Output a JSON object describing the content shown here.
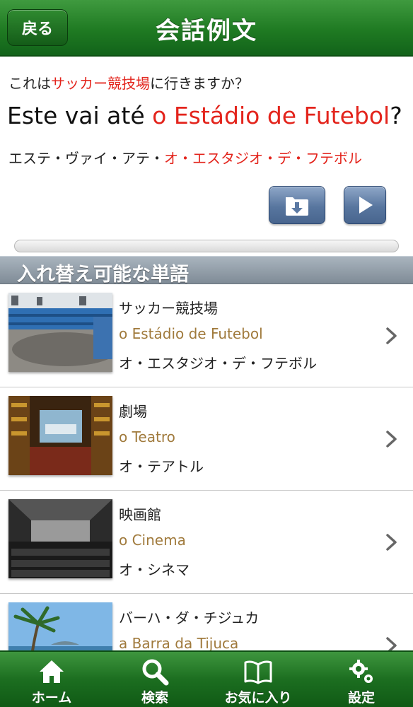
{
  "header": {
    "back_label": "戻る",
    "title": "会話例文"
  },
  "phrase": {
    "ja_prefix": "これは",
    "ja_highlight": "サッカー競技場",
    "ja_suffix": "に行きますか？",
    "pt_prefix": "Este vai até ",
    "pt_highlight": "o Estádio de Futebol",
    "pt_suffix": "?",
    "kana_prefix": "エステ・ヴァイ・アテ・",
    "kana_highlight": "オ・エスタジオ・デ・フテボル",
    "save_icon": "folder-download-icon",
    "play_icon": "play-icon"
  },
  "section": {
    "title": "入れ替え可能な単語"
  },
  "words": [
    {
      "ja": "サッカー競技場",
      "pt": "o Estádio de Futebol",
      "kana": "オ・エスタジオ・デ・フテボル",
      "image": "stadium"
    },
    {
      "ja": "劇場",
      "pt": "o Teatro",
      "kana": "オ・テアトル",
      "image": "theater"
    },
    {
      "ja": "映画館",
      "pt": "o Cinema",
      "kana": "オ・シネマ",
      "image": "cinema"
    },
    {
      "ja": "バーハ・ダ・チジュカ",
      "pt": "a Barra da Tijuca",
      "kana": "",
      "image": "beach"
    }
  ],
  "tabs": [
    {
      "label": "ホーム",
      "icon": "home-icon"
    },
    {
      "label": "検索",
      "icon": "search-icon"
    },
    {
      "label": "お気に入り",
      "icon": "book-icon"
    },
    {
      "label": "設定",
      "icon": "gear-icon"
    }
  ],
  "colors": {
    "header_green": "#1f7a22",
    "highlight_red": "#e3241c",
    "portuguese_brown": "#a07a3c",
    "button_blue": "#58769f"
  }
}
